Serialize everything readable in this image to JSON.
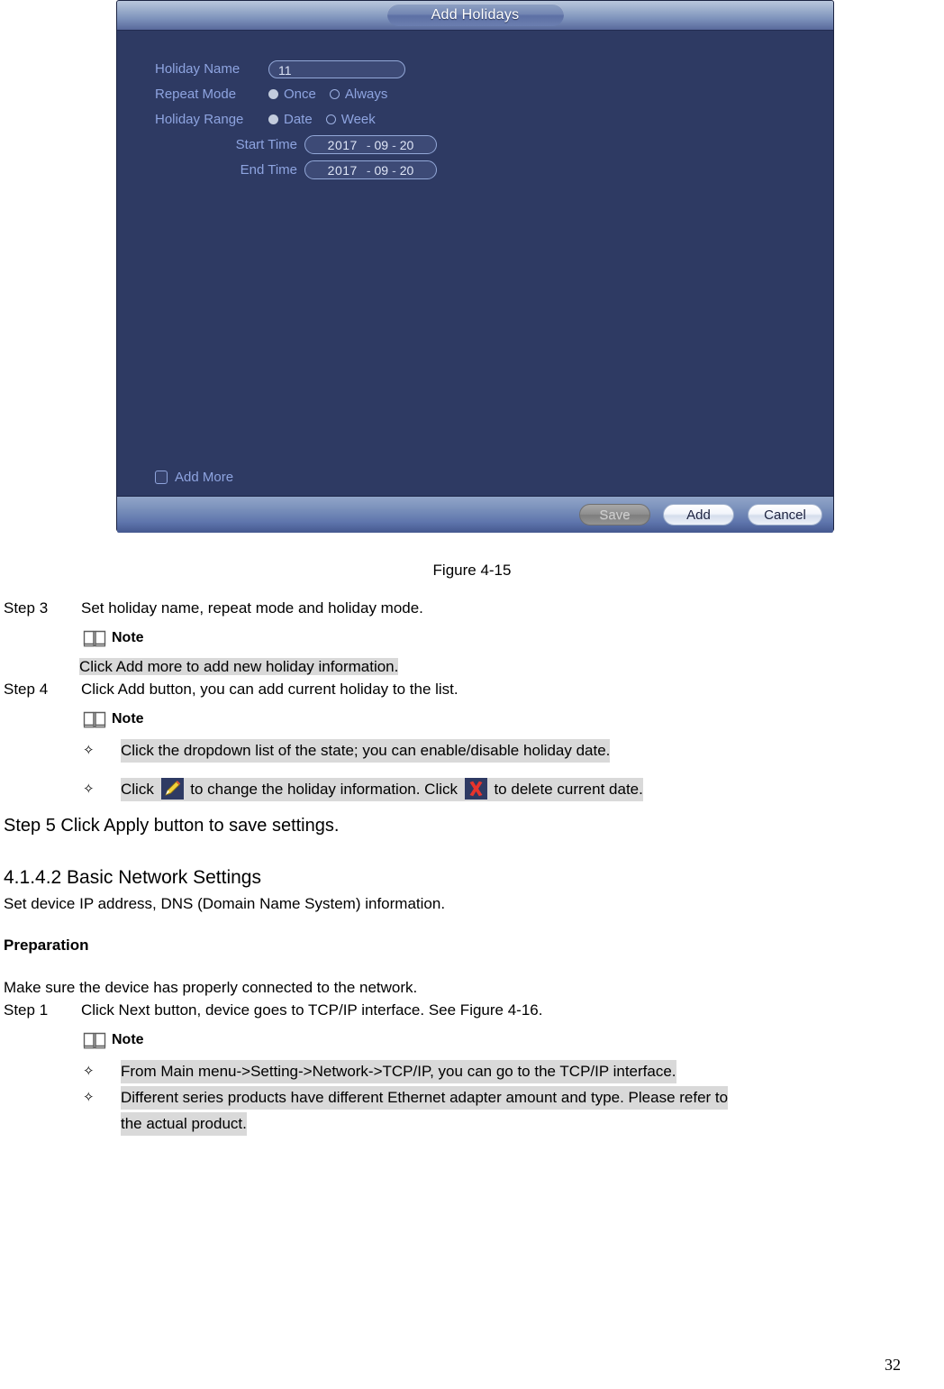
{
  "dialog": {
    "title": "Add Holidays",
    "fields": {
      "holiday_name_label": "Holiday Name",
      "holiday_name_value": "11",
      "repeat_mode_label": "Repeat Mode",
      "repeat_options": [
        {
          "label": "Once",
          "selected": true
        },
        {
          "label": "Always",
          "selected": false
        }
      ],
      "holiday_range_label": "Holiday Range",
      "range_options": [
        {
          "label": "Date",
          "selected": true
        },
        {
          "label": "Week",
          "selected": false
        }
      ],
      "start_time_label": "Start Time",
      "start_time": {
        "year": "2017",
        "month": "09",
        "day": "20",
        "sep": "-"
      },
      "end_time_label": "End Time",
      "end_time": {
        "year": "2017",
        "month": "09",
        "day": "20",
        "sep": "-"
      }
    },
    "add_more_label": "Add More",
    "add_more_checked": false,
    "buttons": {
      "save": "Save",
      "add": "Add",
      "cancel": "Cancel"
    },
    "colors": {
      "body_bg": "#2e3a63",
      "label_text": "#8ea4e0",
      "titlebar_top": "#b9c7dd",
      "titlebar_bottom": "#58699b"
    }
  },
  "document": {
    "figure_caption": "Figure 4-15",
    "step3": {
      "tag": "Step 3",
      "text": "Set holiday name, repeat mode and holiday mode."
    },
    "note_label": "Note",
    "note1_text": "Click Add more to add new holiday information.  ",
    "step4": {
      "tag": "Step 4",
      "text": "Click Add button, you can add current holiday to the list."
    },
    "note2_bullets": [
      {
        "marker": "✧",
        "text": "Click the dropdown list of the state; you can enable/disable holiday date.  "
      }
    ],
    "note2_icon_bullet": {
      "marker": "✧",
      "prefix": "Click ",
      "icon1": "pencil-icon",
      "middle": " to change the holiday information. Click ",
      "icon2": "red-x-icon",
      "suffix": " to delete current date.  "
    },
    "step5": "Step 5  Click Apply button to save settings.",
    "section_heading": "4.1.4.2  Basic Network Settings",
    "section_sub": "Set device IP address, DNS (Domain Name System) information.",
    "preparation_head": "Preparation",
    "prep_text": "Make sure the device has properly connected to the network.",
    "step1": {
      "tag": "Step 1",
      "text": "Click Next button, device goes to TCP/IP interface. See Figure 4-16."
    },
    "note3_bullets": [
      {
        "marker": "✧",
        "text": "From Main menu->Setting->Network->TCP/IP, you can go to the TCP/IP interface."
      },
      {
        "marker": "✧",
        "text": "Different series products have different Ethernet adapter amount and type. Please refer to"
      },
      {
        "marker": "",
        "text": "the actual product.  "
      }
    ],
    "page_number": "32"
  }
}
